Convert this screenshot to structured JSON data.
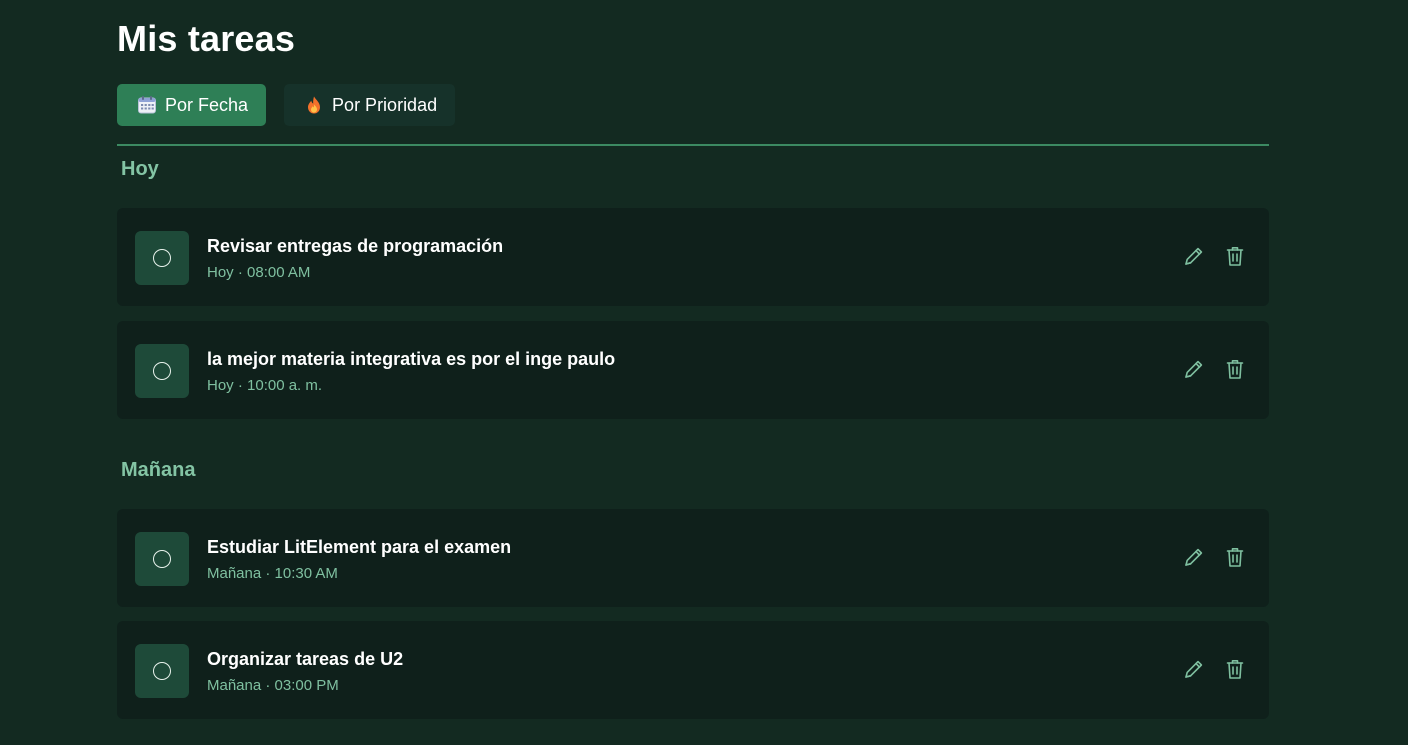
{
  "header": {
    "title": "Mis tareas"
  },
  "tabs": [
    {
      "label": "Por Fecha",
      "icon": "calendar-icon",
      "active": true
    },
    {
      "label": "Por Prioridad",
      "icon": "fire-icon",
      "active": false
    }
  ],
  "colors": {
    "background": "#132a21",
    "accent": "#2e7f56",
    "section_text": "#83c4a4",
    "card_bg": "#0f201b",
    "icon_color": "#7fc0a0"
  },
  "sections": [
    {
      "title": "Hoy",
      "tasks": [
        {
          "title": "Revisar entregas de programación",
          "meta": "Hoy · 08:00 AM",
          "completed": false
        },
        {
          "title": "la mejor materia integrativa es por el inge paulo",
          "meta": "Hoy · 10:00 a. m.",
          "completed": false
        }
      ]
    },
    {
      "title": "Mañana",
      "tasks": [
        {
          "title": "Estudiar LitElement para el examen",
          "meta": "Mañana · 10:30 AM",
          "completed": false
        },
        {
          "title": "Organizar tareas de U2",
          "meta": "Mañana · 03:00 PM",
          "completed": false
        }
      ]
    }
  ]
}
